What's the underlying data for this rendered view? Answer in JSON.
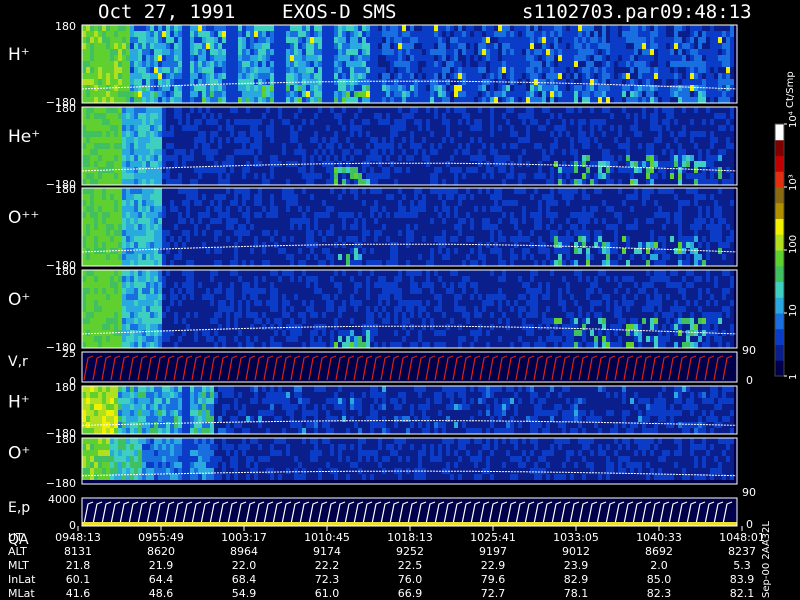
{
  "header": {
    "date": "Oct 27, 1991",
    "instrument": "EXOS-D SMS",
    "file": "s1102703.par",
    "time": "09:48:13"
  },
  "colorbar": {
    "unit_label": "Ct/Smp",
    "tick_labels": [
      "1",
      "10",
      "100",
      "10³",
      "10⁴"
    ],
    "colors": [
      "#00004a",
      "#0a1e8c",
      "#0b3cc8",
      "#1a6fe0",
      "#2aa8e0",
      "#3fcfc0",
      "#40c060",
      "#60d030",
      "#b0e020",
      "#f0f000",
      "#b09000",
      "#8a6a10",
      "#e03010",
      "#c00000",
      "#800000",
      "#ffffff"
    ]
  },
  "panels": [
    {
      "id": "hplus-1",
      "label": "H⁺",
      "ytop": "180",
      "ybottom": "−180"
    },
    {
      "id": "heplus",
      "label": "He⁺",
      "ytop": "180",
      "ybottom": "−180"
    },
    {
      "id": "oplusplus",
      "label": "O⁺⁺",
      "ytop": "180",
      "ybottom": "−180"
    },
    {
      "id": "oplus-1",
      "label": "O⁺",
      "ytop": "180",
      "ybottom": "−180"
    },
    {
      "id": "vr",
      "label": "V,r",
      "ytop": "25",
      "ybottom": "0",
      "right_top": "90",
      "right_bottom": "0"
    },
    {
      "id": "hplus-2",
      "label": "H⁺",
      "ytop": "180",
      "ybottom": "−180"
    },
    {
      "id": "oplus-2",
      "label": "O⁺",
      "ytop": "180",
      "ybottom": "−180"
    },
    {
      "id": "ep",
      "label": "E,p",
      "label2": "QA",
      "ytop": "4000",
      "ybottom": "0",
      "right_top": "90",
      "right_bottom": "0"
    }
  ],
  "footer": {
    "row_labels": [
      "UT",
      "ALT",
      "MLT",
      "InLat",
      "MLat"
    ],
    "columns": [
      [
        "0948:13",
        "8131",
        "21.8",
        "60.1",
        "41.6"
      ],
      [
        "0955:49",
        "8620",
        "21.9",
        "64.4",
        "48.6"
      ],
      [
        "1003:17",
        "8964",
        "22.0",
        "68.4",
        "54.9"
      ],
      [
        "1010:45",
        "9174",
        "22.2",
        "72.3",
        "61.0"
      ],
      [
        "1018:13",
        "9252",
        "22.5",
        "76.0",
        "66.9"
      ],
      [
        "1025:41",
        "9197",
        "22.9",
        "79.6",
        "72.7"
      ],
      [
        "1033:05",
        "9012",
        "23.9",
        "82.9",
        "78.1"
      ],
      [
        "1040:33",
        "8692",
        "2.0",
        "85.0",
        "82.3"
      ],
      [
        "1048:01",
        "8237",
        "5.3",
        "83.9",
        "82.1"
      ]
    ],
    "vertical_note": "Sep-00 2AA32L"
  },
  "chart_data": {
    "type": "heatmap",
    "title": "Oct 27, 1991   EXOS-D SMS",
    "xlabel": "UT",
    "x_ticks": [
      "0948:13",
      "0955:49",
      "1003:17",
      "1010:45",
      "1018:13",
      "1025:41",
      "1033:05",
      "1040:33",
      "1048:01"
    ],
    "ylim_pitch": [
      -180,
      180
    ],
    "color_scale": "log",
    "color_range": [
      1,
      10000
    ],
    "colorbar_label": "Ct/Smp",
    "series": [
      {
        "name": "H⁺",
        "ylim": [
          -180,
          180
        ]
      },
      {
        "name": "He⁺",
        "ylim": [
          -180,
          180
        ]
      },
      {
        "name": "O⁺⁺",
        "ylim": [
          -180,
          180
        ]
      },
      {
        "name": "O⁺",
        "ylim": [
          -180,
          180
        ]
      },
      {
        "name": "V,r",
        "ylim": [
          0,
          25
        ]
      },
      {
        "name": "H⁺",
        "ylim": [
          -180,
          180
        ]
      },
      {
        "name": "O⁺",
        "ylim": [
          -180,
          180
        ]
      },
      {
        "name": "E,p",
        "ylim": [
          0,
          4000
        ]
      }
    ]
  }
}
